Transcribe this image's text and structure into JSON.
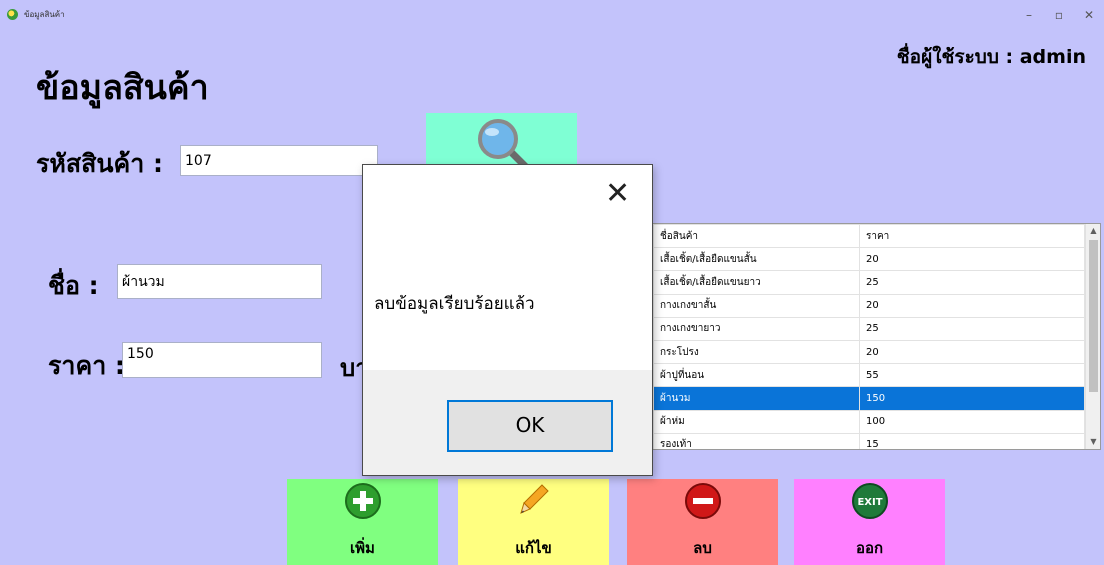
{
  "window": {
    "title": "ข้อมูลสินค้า",
    "controls": {
      "minimize": "–",
      "maximize": "▫",
      "close": "✕"
    }
  },
  "header": {
    "page_title": "ข้อมูลสินค้า",
    "user_info": "ชื่อผู้ใช้ระบบ : admin"
  },
  "form": {
    "code_label": "รหัสสินค้า :",
    "code_value": "107",
    "name_label": "ชื่อ :",
    "name_value": "ผ้านวม",
    "price_label": "ราคา :",
    "price_value": "150",
    "price_unit": "บา"
  },
  "search_button": {
    "icon": "magnifier-icon"
  },
  "product_table": {
    "columns": [
      "ชื่อสินค้า",
      "ราคา"
    ],
    "rows": [
      {
        "name": "เสื้อเชิ้ต/เสื้อยืดแขนสั้น",
        "price": "20"
      },
      {
        "name": "เสื้อเชิ้ต/เสื้อยืดแขนยาว",
        "price": "25"
      },
      {
        "name": "กางเกงขาสั้น",
        "price": "20"
      },
      {
        "name": "กางเกงขายาว",
        "price": "25"
      },
      {
        "name": "กระโปรง",
        "price": "20"
      },
      {
        "name": "ผ้าปูที่นอน",
        "price": "55"
      },
      {
        "name": "ผ้านวม",
        "price": "150",
        "selected": true
      },
      {
        "name": "ผ้าห่ม",
        "price": "100"
      },
      {
        "name": "รองเท้า",
        "price": "15"
      }
    ]
  },
  "actions": [
    {
      "label": "เพิ่ม",
      "icon": "add-icon",
      "color": "#80ff80"
    },
    {
      "label": "แก้ไข",
      "icon": "pencil-icon",
      "color": "#ffff80"
    },
    {
      "label": "ลบ",
      "icon": "remove-icon",
      "color": "#ff8080"
    },
    {
      "label": "ออก",
      "icon": "exit-icon",
      "color": "#ff80ff"
    }
  ],
  "dialog": {
    "message": "ลบข้อมูลเรียบร้อยแล้ว",
    "ok_label": "OK",
    "close_glyph": "✕"
  },
  "colors": {
    "background": "#c3c3fb",
    "search_button": "#7fffd4",
    "selection": "#0a74d8",
    "ok_border": "#0078d7"
  }
}
